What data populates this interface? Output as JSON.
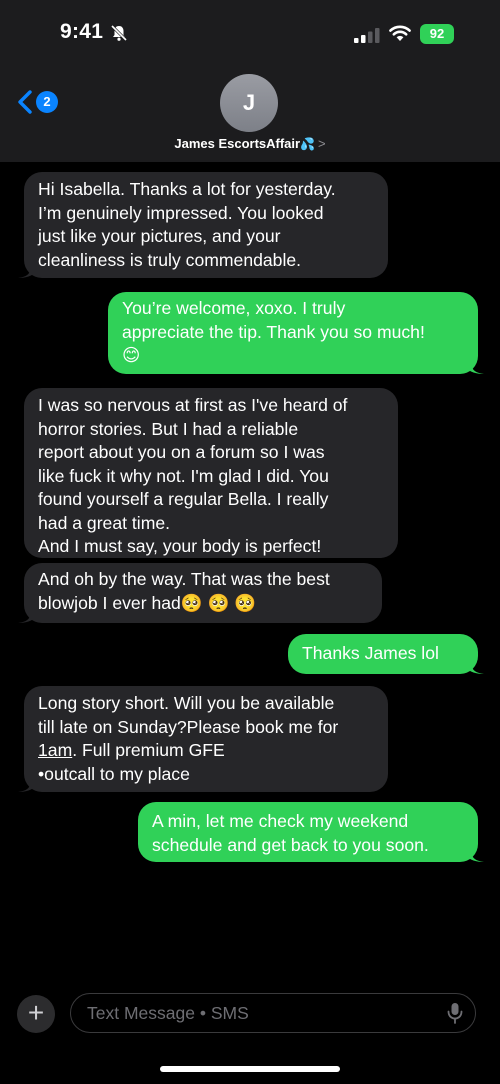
{
  "status_bar": {
    "time": "9:41",
    "battery": "92"
  },
  "header": {
    "back_badge": "2",
    "avatar_initial": "J",
    "contact_name": "James EscortsAffair",
    "contact_emoji": "💦",
    "chevron": ">"
  },
  "messages": [
    {
      "from": "them",
      "text": "Hi Isabella. Thanks a lot for yesterday.\nI’m genuinely impressed. You looked\njust like your pictures, and your\ncleanliness is truly commendable."
    },
    {
      "from": "me",
      "text": "You’re welcome, xoxo. I truly\nappreciate the tip. Thank you so much!\n😊"
    },
    {
      "from": "them",
      "text": "I was so nervous at first as I've heard of\nhorror stories. But I had a reliable\nreport about you on a forum so I was\nlike fuck it why not. I'm glad I did. You\nfound yourself a regular Bella. I really\nhad a great time.\nAnd I must say, your body is perfect!"
    },
    {
      "from": "them",
      "text": "And oh by the way. That was the best\nblowjob I ever had🥺 🥺 🥺"
    },
    {
      "from": "me",
      "text": "Thanks James lol"
    },
    {
      "from": "them",
      "text_a": "Long story short. Will you be available\ntill late on Sunday?Please book me for\n",
      "text_link": "1am",
      "text_b": ". Full premium GFE\n•outcall to my place"
    },
    {
      "from": "me",
      "text": "A min, let me check my weekend\nschedule and get back to you soon."
    }
  ],
  "input": {
    "placeholder": "Text Message • SMS",
    "plus": "+"
  },
  "colors": {
    "incoming": "#262629",
    "outgoing": "#30d158",
    "accent": "#0a84ff"
  }
}
